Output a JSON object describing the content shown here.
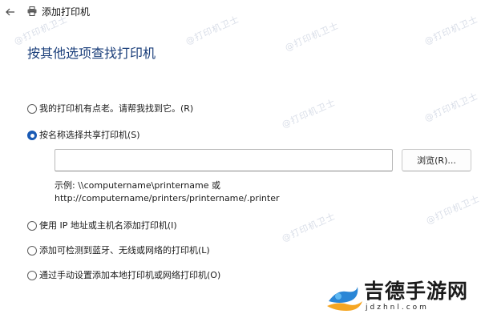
{
  "window": {
    "title": "添加打印机"
  },
  "heading": "按其他选项查找打印机",
  "options": [
    {
      "label": "我的打印机有点老。请帮我找到它。(R)",
      "selected": false
    },
    {
      "label": "按名称选择共享打印机(S)",
      "selected": true
    },
    {
      "label": "使用 IP 地址或主机名添加打印机(I)",
      "selected": false
    },
    {
      "label": "添加可检测到蓝牙、无线或网络的打印机(L)",
      "selected": false
    },
    {
      "label": "通过手动设置添加本地打印机或网络打印机(O)",
      "selected": false
    }
  ],
  "share_input": {
    "value": ""
  },
  "browse_label": "浏览(R)...",
  "example": {
    "line1": "示例: \\\\computername\\printername 或",
    "line2": "http://computername/printers/printername/.printer"
  },
  "watermark": "@打印机卫士",
  "logo": {
    "name": "吉德手游网",
    "domain": "jdzhnl.com"
  },
  "colors": {
    "accent": "#1a5bb5",
    "heading": "#1a3e7a",
    "watermark": "#d9dee8"
  }
}
